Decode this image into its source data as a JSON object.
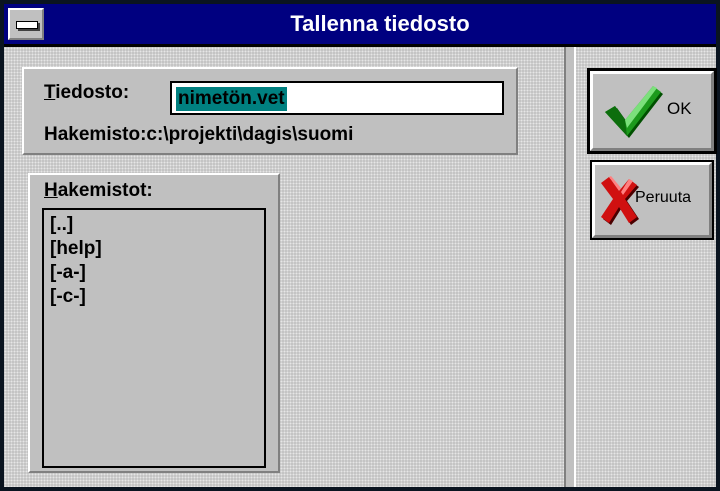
{
  "window": {
    "title": "Tallenna tiedosto"
  },
  "file": {
    "label_hotkey": "T",
    "label_rest": "iedosto:",
    "value": "nimetön.vet"
  },
  "directory": {
    "label": "Hakemisto:",
    "path": "c:\\projekti\\dagis\\suomi"
  },
  "directories": {
    "label_hotkey": "H",
    "label_rest": "akemistot:",
    "items": [
      "[..]",
      "[help]",
      "[-a-]",
      "[-c-]"
    ]
  },
  "buttons": {
    "ok": {
      "label": "OK",
      "icon": "checkmark-icon"
    },
    "cancel": {
      "label": "Peruuta",
      "icon": "red-x-icon"
    }
  },
  "colors": {
    "titlebar": "#000080",
    "face": "#c0c0c0",
    "selection": "#008080",
    "ok_check": "#008000",
    "cancel_x": "#c00000"
  }
}
